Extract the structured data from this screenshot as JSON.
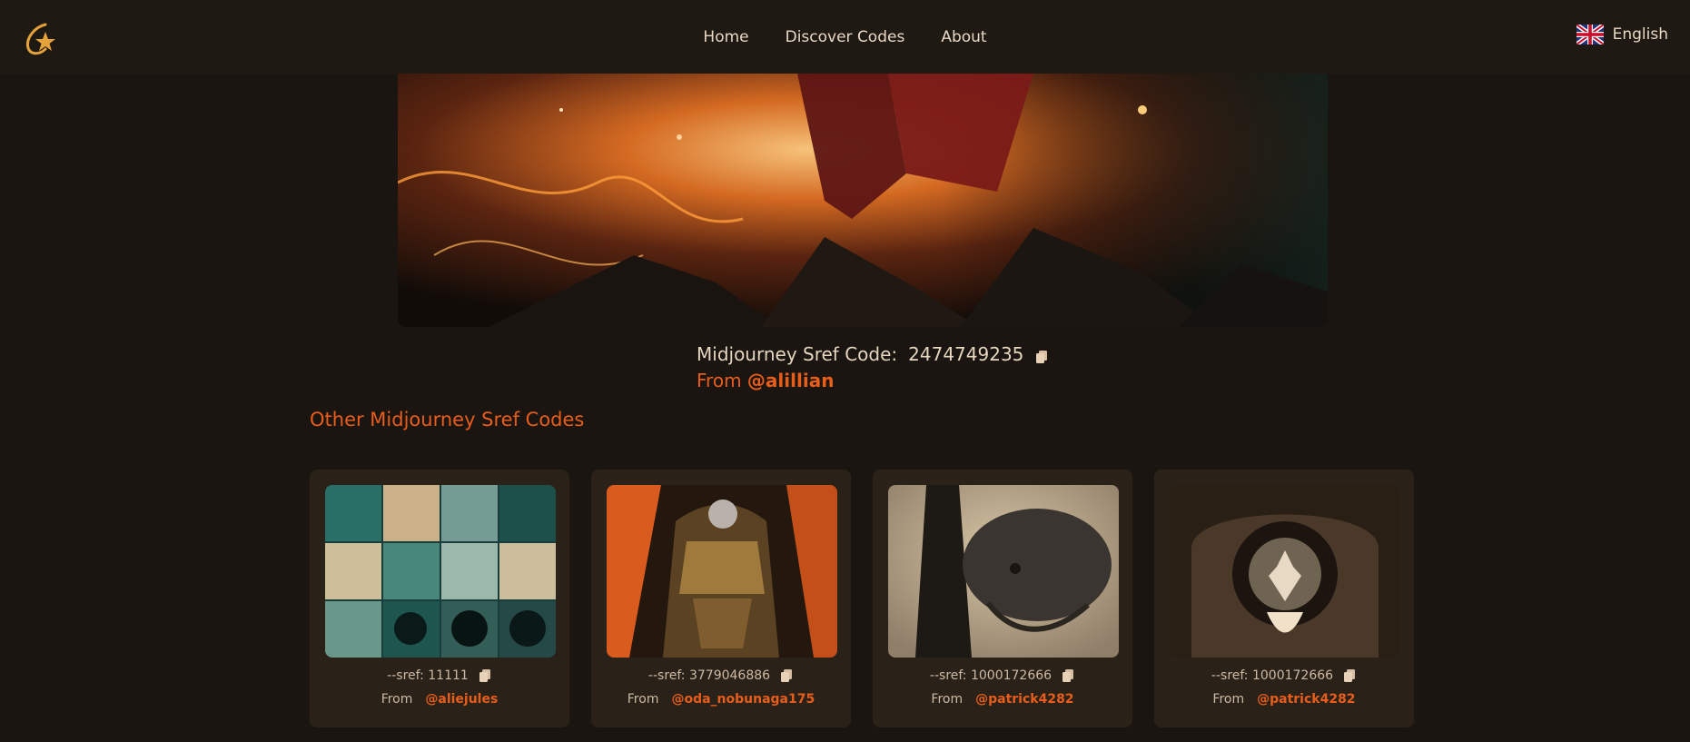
{
  "header": {
    "nav": [
      {
        "label": "Home"
      },
      {
        "label": "Discover Codes"
      },
      {
        "label": "About"
      }
    ],
    "language": "English",
    "logo_icon": "shooting-star-icon",
    "flag_icon": "uk-flag-icon"
  },
  "hero": {
    "code_prefix": "Midjourney Sref Code:",
    "code_value": "2474749235",
    "from_label": "From",
    "author": "@alillian"
  },
  "section": {
    "title": "Other Midjourney Sref Codes"
  },
  "cards": [
    {
      "sref_label": "--sref: 11111",
      "from_label": "From",
      "author": "@aliejules"
    },
    {
      "sref_label": "--sref: 3779046886",
      "from_label": "From",
      "author": "@oda_nobunaga175"
    },
    {
      "sref_label": "--sref: 1000172666",
      "from_label": "From",
      "author": "@patrick4282"
    },
    {
      "sref_label": "--sref: 1000172666",
      "from_label": "From",
      "author": "@patrick4282"
    }
  ],
  "colors": {
    "background": "#1a1510",
    "card": "#2a2219",
    "accent": "#e85d1a",
    "text": "#e8d8c4"
  }
}
